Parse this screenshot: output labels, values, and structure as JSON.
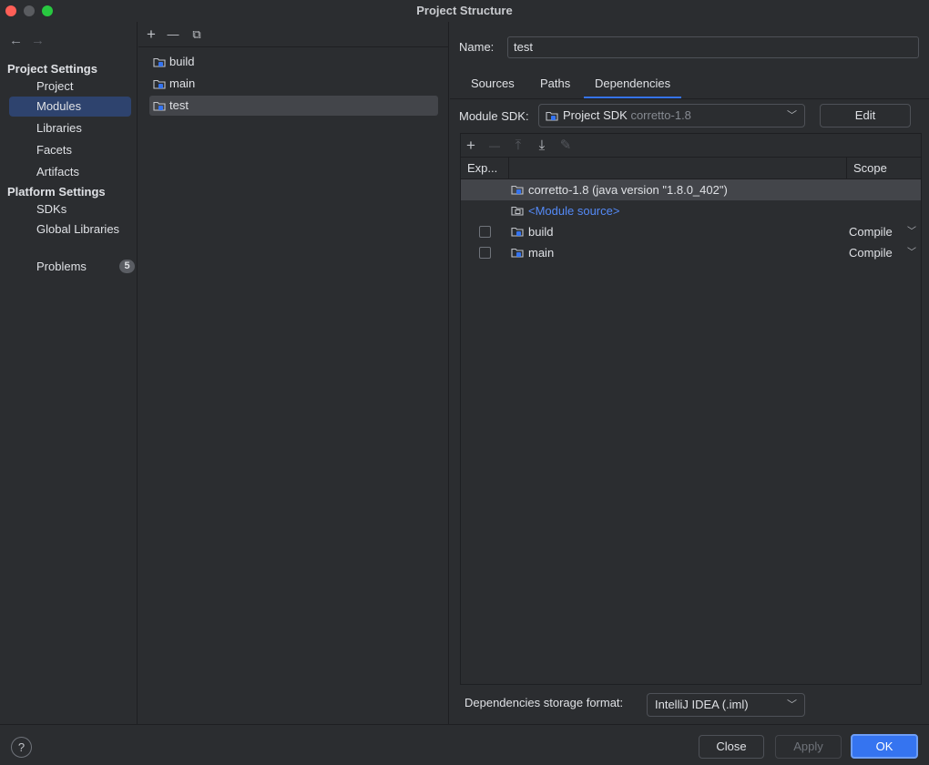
{
  "window": {
    "title": "Project Structure"
  },
  "sidebar": {
    "project_settings_header": "Project Settings",
    "project_items": [
      {
        "label": "Project"
      },
      {
        "label": "Modules"
      },
      {
        "label": "Libraries"
      },
      {
        "label": "Facets"
      },
      {
        "label": "Artifacts"
      }
    ],
    "platform_settings_header": "Platform Settings",
    "platform_items": [
      {
        "label": "SDKs"
      },
      {
        "label": "Global Libraries"
      }
    ],
    "problems": {
      "label": "Problems",
      "count": "5"
    }
  },
  "modules": {
    "toolbar": {
      "add": "+",
      "remove": "—",
      "copy": "⧉"
    },
    "items": [
      {
        "label": "build"
      },
      {
        "label": "main"
      },
      {
        "label": "test"
      }
    ],
    "selected": "test"
  },
  "details": {
    "name_label": "Name:",
    "name_value": "test",
    "tabs": [
      {
        "label": "Sources"
      },
      {
        "label": "Paths"
      },
      {
        "label": "Dependencies"
      }
    ],
    "active_tab": "Dependencies",
    "module_sdk_label": "Module SDK:",
    "module_sdk_value": "Project SDK",
    "module_sdk_hint": "corretto-1.8",
    "edit_button": "Edit",
    "deps_toolbar": {
      "add": "+",
      "remove": "—",
      "up": "⤒",
      "down": "⤓",
      "edit": "✎"
    },
    "columns": {
      "export": "Exp...",
      "scope": "Scope"
    },
    "dependencies": [
      {
        "name": "corretto-1.8 (java version \"1.8.0_402\")",
        "scope": ""
      },
      {
        "name": "<Module source>",
        "scope": ""
      },
      {
        "name": "build",
        "scope": "Compile"
      },
      {
        "name": "main",
        "scope": "Compile"
      }
    ],
    "storage_label": "Dependencies storage format:",
    "storage_value": "IntelliJ IDEA (.iml)"
  },
  "footer": {
    "help": "?",
    "close": "Close",
    "apply": "Apply",
    "ok": "OK"
  },
  "colors": {
    "accent": "#3574f0",
    "selection": "#2e436e",
    "link": "#548af7",
    "background": "#2b2d30"
  }
}
